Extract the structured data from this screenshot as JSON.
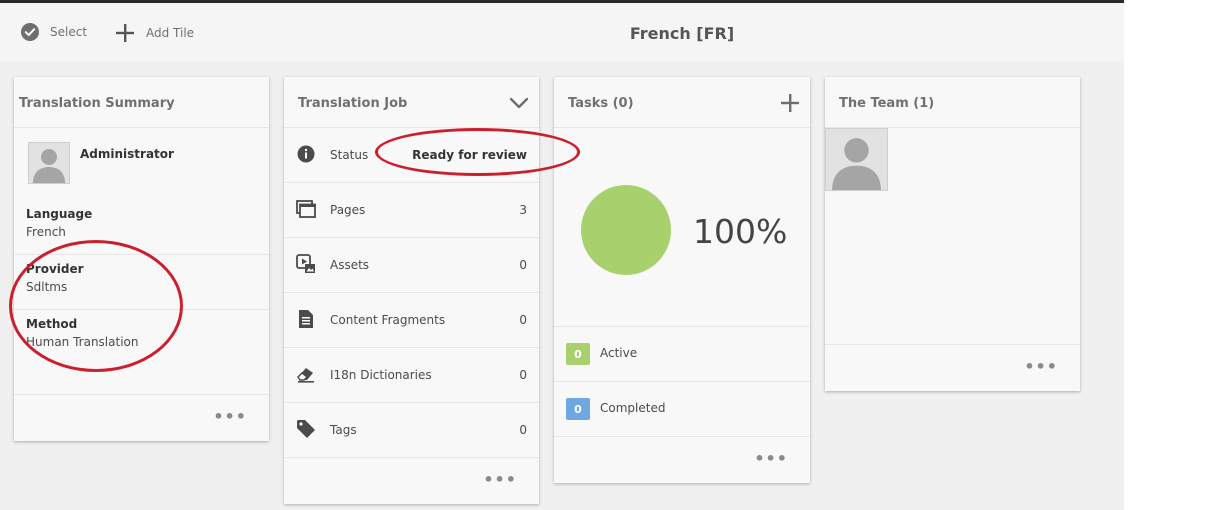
{
  "toolbar": {
    "select_label": "Select",
    "add_tile_label": "Add Tile",
    "title": "French [FR]"
  },
  "summary": {
    "title": "Translation Summary",
    "user_name": "Administrator",
    "language_label": "Language",
    "language_value": "French",
    "provider_label": "Provider",
    "provider_value": "Sdltms",
    "method_label": "Method",
    "method_value": "Human Translation",
    "more": "•••"
  },
  "job": {
    "title": "Translation Job",
    "rows": [
      {
        "label": "Status",
        "value": "Ready for review"
      },
      {
        "label": "Pages",
        "value": "3"
      },
      {
        "label": "Assets",
        "value": "0"
      },
      {
        "label": "Content Fragments",
        "value": "0"
      },
      {
        "label": "I18n Dictionaries",
        "value": "0"
      },
      {
        "label": "Tags",
        "value": "0"
      }
    ],
    "more": "•••"
  },
  "tasks": {
    "title": "Tasks (0)",
    "percent": "100%",
    "progress_fraction": 1.0,
    "active_count": "0",
    "active_label": "Active",
    "completed_count": "0",
    "completed_label": "Completed",
    "more": "•••"
  },
  "team": {
    "title": "The Team (1)",
    "more": "•••"
  },
  "colors": {
    "progress_green": "#a8d16e",
    "active_badge": "#a8d16e",
    "completed_badge": "#6fa8e0",
    "annotation_red": "#cc1f2e"
  },
  "icons": {
    "select": "checkmark-circle-icon",
    "add_tile": "plus-icon",
    "collapse": "chevron-down-icon",
    "add_task": "plus-icon",
    "status": "info-icon",
    "pages": "pages-icon",
    "assets": "assets-icon",
    "content_fragments": "document-icon",
    "dictionaries": "eraser-icon",
    "tags": "tag-icon"
  }
}
